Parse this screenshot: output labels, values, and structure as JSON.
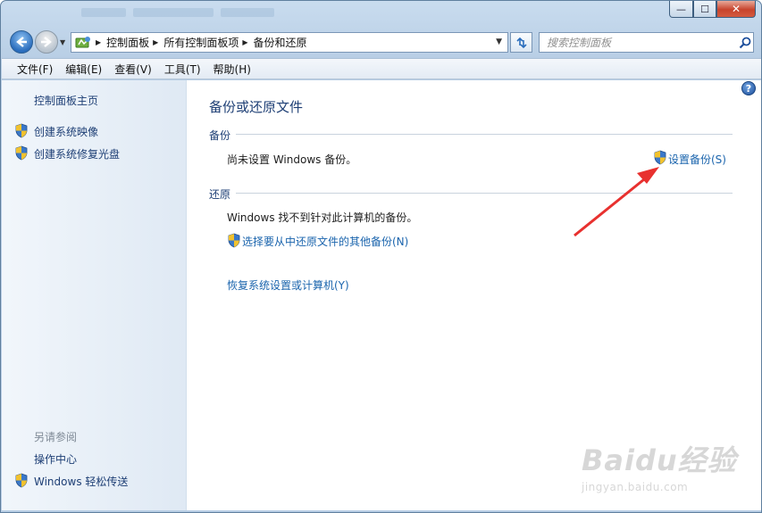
{
  "window": {
    "controls": {
      "minimize": "—",
      "maximize": "☐",
      "close": "✕"
    }
  },
  "address": {
    "breadcrumbs": [
      "控制面板",
      "所有控制面板项",
      "备份和还原"
    ],
    "search_placeholder": "搜索控制面板"
  },
  "menu": [
    "文件(F)",
    "编辑(E)",
    "查看(V)",
    "工具(T)",
    "帮助(H)"
  ],
  "sidebar": {
    "home_link": "控制面板主页",
    "tasks": [
      "创建系统映像",
      "创建系统修复光盘"
    ],
    "see_also_label": "另请参阅",
    "see_also": [
      "操作中心",
      "Windows 轻松传送"
    ]
  },
  "main": {
    "title": "备份或还原文件",
    "backup_section": "备份",
    "backup_status": "尚未设置 Windows 备份。",
    "setup_backup_link": "设置备份(S)",
    "restore_section": "还原",
    "restore_status": "Windows 找不到针对此计算机的备份。",
    "other_backup_link": "选择要从中还原文件的其他备份(N)",
    "recover_link": "恢复系统设置或计算机(Y)"
  },
  "colors": {
    "link": "#1a64ad",
    "heading": "#1e3f75",
    "annotation_arrow": "#e8312f"
  },
  "watermark": {
    "brand": "Baidu经验",
    "url": "jingyan.baidu.com"
  }
}
